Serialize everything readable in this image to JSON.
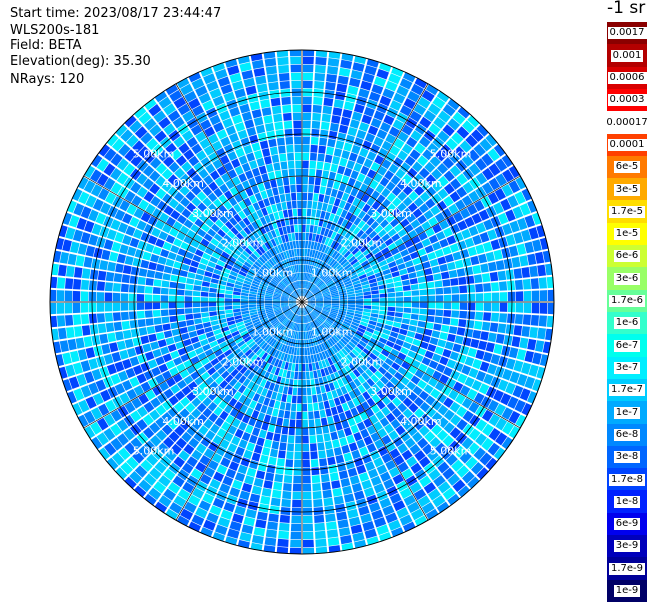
{
  "header": {
    "start_time": "Start time: 2023/08/17 23:44:47",
    "instrument": "WLS200s-181",
    "field": "Field: BETA",
    "elevation": "Elevation(deg): 35.30",
    "nrays": "NRays: 120"
  },
  "colorbar": {
    "title": "-1 sr",
    "levels": [
      {
        "label": "0.0017",
        "color": "#8a0000"
      },
      {
        "label": "0.001",
        "color": "#b30000"
      },
      {
        "label": "0.0006",
        "color": "#d80000"
      },
      {
        "label": "0.0003",
        "color": "#ff0000"
      },
      {
        "label": "0.00017",
        "color": "#ffffff"
      },
      {
        "label": "0.0001",
        "color": "#ff4000"
      },
      {
        "label": "6e-5",
        "color": "#ff7a00"
      },
      {
        "label": "3e-5",
        "color": "#ffaa00"
      },
      {
        "label": "1.7e-5",
        "color": "#ffdd00"
      },
      {
        "label": "1e-5",
        "color": "#ffff00"
      },
      {
        "label": "6e-6",
        "color": "#ccff33"
      },
      {
        "label": "3e-6",
        "color": "#99ff66"
      },
      {
        "label": "1.7e-6",
        "color": "#66ff99"
      },
      {
        "label": "1e-6",
        "color": "#33ffcc"
      },
      {
        "label": "6e-7",
        "color": "#00ffee"
      },
      {
        "label": "3e-7",
        "color": "#00eeff"
      },
      {
        "label": "1.7e-7",
        "color": "#00ccff"
      },
      {
        "label": "1e-7",
        "color": "#00aaff"
      },
      {
        "label": "6e-8",
        "color": "#0088ff"
      },
      {
        "label": "3e-8",
        "color": "#0066ff"
      },
      {
        "label": "1.7e-8",
        "color": "#0044ff"
      },
      {
        "label": "1e-8",
        "color": "#0022ff"
      },
      {
        "label": "6e-9",
        "color": "#0000ee"
      },
      {
        "label": "3e-9",
        "color": "#0000bb"
      },
      {
        "label": "1.7e-9",
        "color": "#000099"
      },
      {
        "label": "1e-9",
        "color": "#000066"
      }
    ]
  },
  "chart_data": {
    "type": "heatmap",
    "projection": "polar-ppi",
    "rays": 120,
    "range_rings_km": [
      1,
      2,
      3,
      4,
      5,
      6
    ],
    "ring_labels": [
      "1.00km",
      "2.00km",
      "3.00km",
      "4.00km",
      "5.00km"
    ],
    "max_range_km": 6.0,
    "spoke_angles_deg": [
      0,
      30,
      60,
      90,
      120,
      150,
      180,
      210,
      240,
      270,
      300,
      330
    ],
    "label_diagonals_deg": [
      45,
      135,
      225,
      315
    ],
    "grid": true,
    "palette": [
      "#00aaff",
      "#0088ff",
      "#0066ff",
      "#00ccff",
      "#00eeff",
      "#0044ff"
    ]
  }
}
